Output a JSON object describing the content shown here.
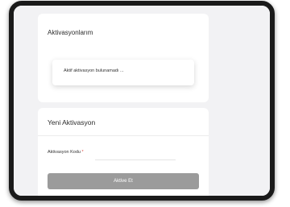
{
  "activations": {
    "title": "Aktivasyonlarım",
    "empty_message": "Aktif aktivasyon bulunamadı ..."
  },
  "new_activation": {
    "title": "Yeni Aktivasyon",
    "code_label": "Aktivasyon Kodu",
    "required_mark": "*",
    "code_value": "",
    "submit_label": "Aktive Et"
  },
  "colors": {
    "button_bg": "#9b9b9b",
    "required": "#e0453f",
    "screen_bg": "#f2f2f4"
  }
}
